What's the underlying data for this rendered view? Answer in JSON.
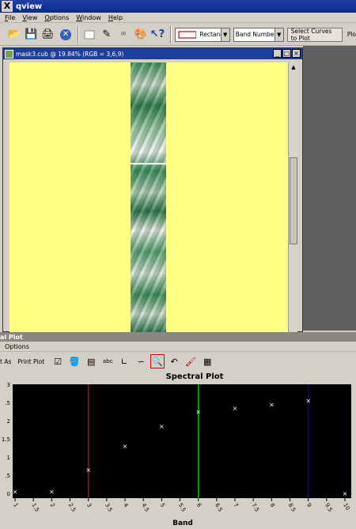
{
  "app": {
    "title": "qview"
  },
  "menu": [
    "File",
    "View",
    "Options",
    "Window",
    "Help"
  ],
  "toolbar": {
    "shape_select": "Rectangle",
    "mode_select": "Band Number",
    "select_curves_label": "Select Curves to Plot",
    "plot_label_partial": "Plo"
  },
  "cube_window": {
    "title": "mask3.cub @ 19.84% (RGB = 3,6,9)",
    "min_label": "_",
    "max_label": "□",
    "close_label": "×"
  },
  "plot_window": {
    "title_partial": "al Plot",
    "menu_options": "Options",
    "save_as_partial": "t As",
    "print_label": "Print Plot"
  },
  "chart_data": {
    "type": "scatter",
    "title": "Spectral Plot",
    "xlabel": "Band",
    "ylabel": "",
    "xlim": [
      1,
      10
    ],
    "x_ticks": [
      "1",
      "1.5",
      "2",
      "2.5",
      "3",
      "3.5",
      "4",
      "4.5",
      "5",
      "5.5",
      "6",
      "6.5",
      "7",
      "7.5",
      "8",
      "8.5",
      "9",
      "9.5",
      "10"
    ],
    "y_ticks": [
      "0",
      ".5",
      "1",
      "1.5",
      "2",
      ".5",
      "3"
    ],
    "points": [
      {
        "x": 1,
        "y": 0.05
      },
      {
        "x": 2,
        "y": 0.05
      },
      {
        "x": 3,
        "y": 0.65
      },
      {
        "x": 4,
        "y": 1.3
      },
      {
        "x": 5,
        "y": 1.85
      },
      {
        "x": 6,
        "y": 2.25
      },
      {
        "x": 7,
        "y": 2.35
      },
      {
        "x": 8,
        "y": 2.45
      },
      {
        "x": 9,
        "y": 2.55
      },
      {
        "x": 10,
        "y": 0.0
      }
    ],
    "markers": [
      {
        "x": 3,
        "color": "#ff0000"
      },
      {
        "x": 6,
        "color": "#00cc00"
      },
      {
        "x": 9,
        "color": "#0000ff"
      }
    ],
    "background": "#000000",
    "point_color": "#ffffff"
  }
}
